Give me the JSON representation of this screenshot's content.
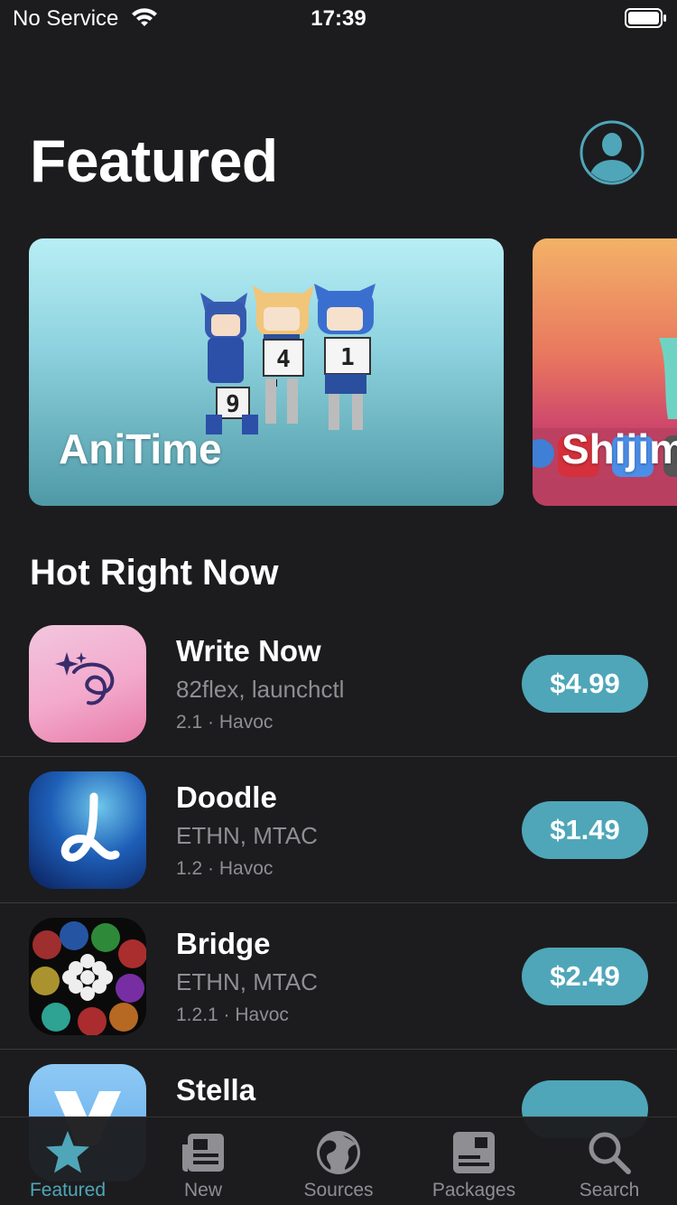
{
  "status": {
    "carrier": "No Service",
    "time": "17:39"
  },
  "header": {
    "title": "Featured"
  },
  "carousel": [
    {
      "label": "AniTime"
    },
    {
      "label": "Shijim"
    }
  ],
  "section": {
    "title": "Hot Right Now"
  },
  "apps": [
    {
      "name": "Write Now",
      "developers": "82flex, launchctl",
      "meta": "2.1 · Havoc",
      "price": "$4.99"
    },
    {
      "name": "Doodle",
      "developers": "ETHN, MTAC",
      "meta": "1.2 · Havoc",
      "price": "$1.49"
    },
    {
      "name": "Bridge",
      "developers": "ETHN, MTAC",
      "meta": "1.2.1 · Havoc",
      "price": "$2.49"
    },
    {
      "name": "Stella",
      "developers": "",
      "meta": "",
      "price": ""
    }
  ],
  "tabs": [
    {
      "label": "Featured",
      "icon": "star-icon",
      "active": true
    },
    {
      "label": "New",
      "icon": "news-icon",
      "active": false
    },
    {
      "label": "Sources",
      "icon": "globe-icon",
      "active": false
    },
    {
      "label": "Packages",
      "icon": "package-icon",
      "active": false
    },
    {
      "label": "Search",
      "icon": "search-icon",
      "active": false
    }
  ],
  "colors": {
    "accent": "#4fa6b9",
    "background": "#1c1c1e",
    "secondary_text": "#8e8e93"
  }
}
